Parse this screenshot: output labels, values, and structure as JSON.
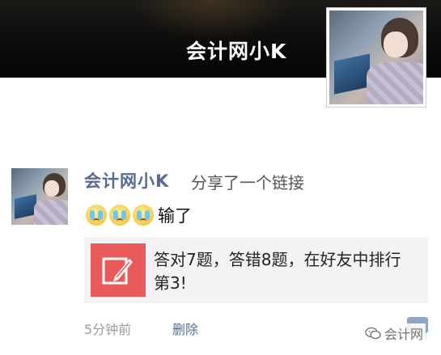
{
  "cover": {
    "name": "会计网小K"
  },
  "post": {
    "author": "会计网小K",
    "action": "分享了一个链接",
    "emojis": [
      "crying-face-icon",
      "crying-face-icon",
      "crying-face-icon"
    ],
    "text": "输了",
    "link": {
      "icon": "pen-icon",
      "title": "答对7题，答错8题，在好友中排行第3!"
    },
    "time": "5分钟前",
    "delete_label": "删除"
  },
  "watermark": {
    "text": "会计网"
  },
  "colors": {
    "link_blue": "#576b95",
    "thumb_red": "#ea5a5a",
    "card_bg": "#f3f3f5"
  }
}
